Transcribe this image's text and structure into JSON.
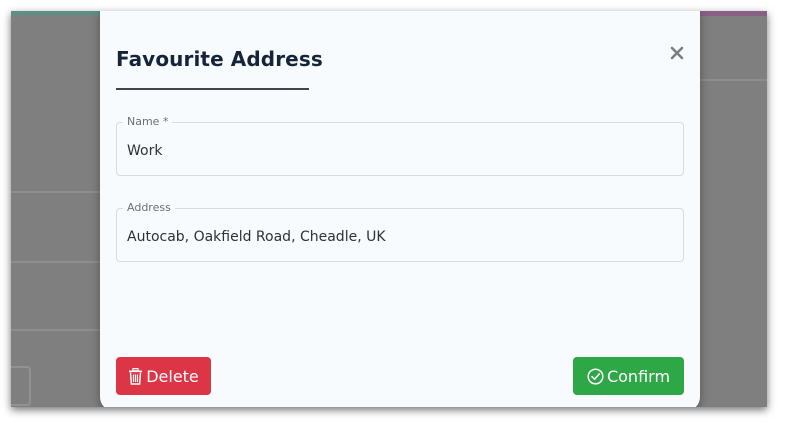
{
  "modal": {
    "title": "Favourite Address",
    "close_label": "×"
  },
  "fields": {
    "name": {
      "label": "Name *",
      "value": "Work"
    },
    "address": {
      "label": "Address",
      "value": "Autocab, Oakfield Road, Cheadle, UK"
    }
  },
  "actions": {
    "delete_label": "Delete",
    "confirm_label": "Confirm"
  },
  "icons": {
    "close": "close-icon",
    "delete": "trash-icon",
    "confirm": "check-circle-icon"
  },
  "colors": {
    "delete": "#dc3546",
    "confirm": "#2ea846",
    "title": "#16243a",
    "overlay": "#7f7f7f"
  }
}
